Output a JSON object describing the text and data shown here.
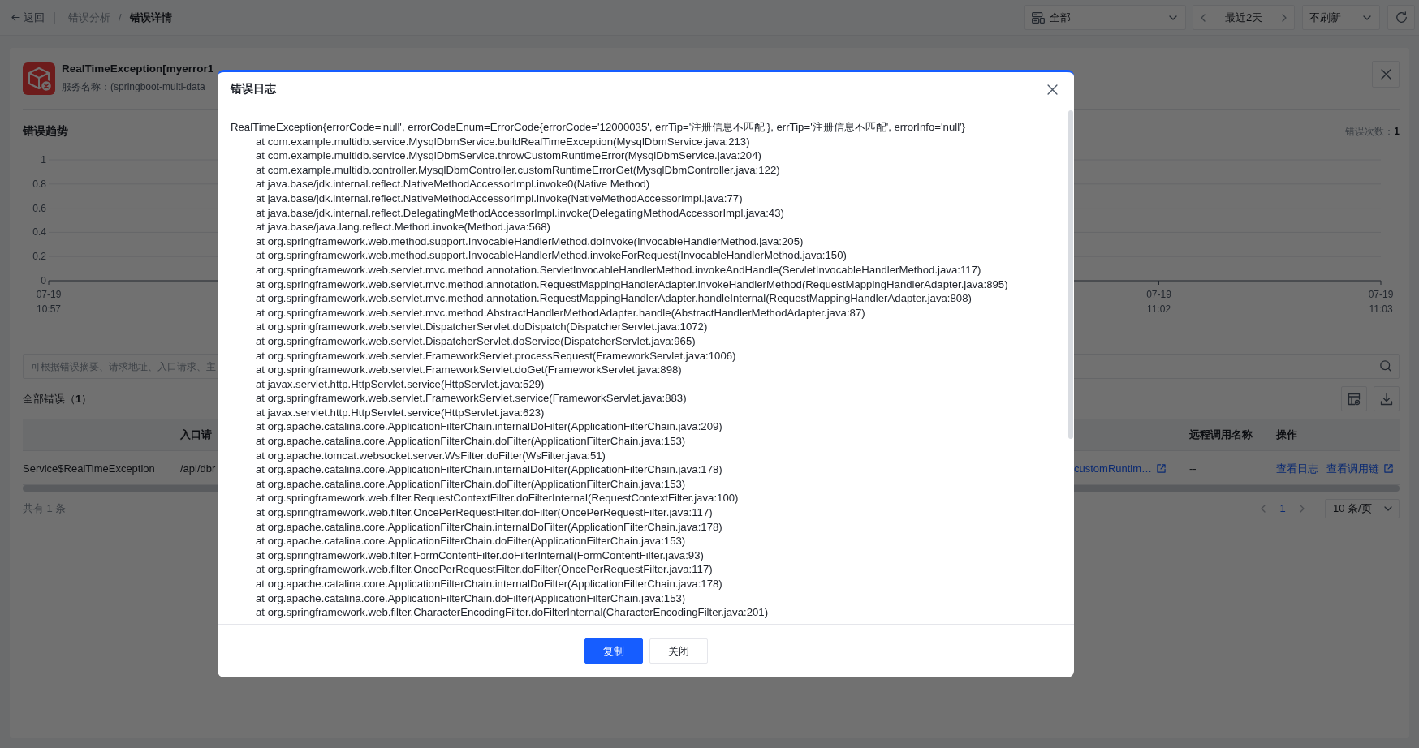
{
  "top_bar": {
    "back": "返回",
    "breadcrumb": {
      "separator": "/",
      "items": [
        {
          "label": "错误分析",
          "selected": false
        },
        {
          "label": "错误详情",
          "selected": true
        }
      ]
    },
    "environment_select": {
      "value": "全部"
    },
    "time_range": {
      "value": "最近2天"
    },
    "refresh_select": {
      "value": "不刷新"
    }
  },
  "error_header": {
    "title": "RealTimeException[myerror1",
    "service": "服务名称：(springboot-multi-data"
  },
  "trend": {
    "title": "错误趋势",
    "error_count": "错误次数：**1**",
    "chart_data": {
      "type": "line",
      "categories": [
        "07-19 10:57",
        null,
        null,
        null,
        null,
        "07-19 11:02",
        "07-19 11:03"
      ],
      "ylim": [
        0,
        1
      ],
      "yticks": [
        0,
        0.2,
        0.4,
        0.6,
        0.8,
        1
      ],
      "grid": true
    }
  },
  "search": {
    "placeholder": "可根据错误摘要、请求地址、入口请求、主"
  },
  "error_list": {
    "title": "全部错误（**1**）"
  },
  "table": {
    "columns": {
      "entry_request": "入口请",
      "remote_call_name": "远程调用名称",
      "actions": "操作"
    },
    "rows": [
      {
        "column_1": "Service$RealTimeException",
        "entry_request": "/api/dbr",
        "column_3": {
          "label": "customRuntim…",
          "external": true
        },
        "remote_call_name": "--",
        "actions": [
          {
            "label": "查看日志",
            "external": false
          },
          {
            "label": "查看调用链",
            "external": true
          }
        ]
      }
    ]
  },
  "pagination": {
    "total": "共有 1 条",
    "pages": [
      {
        "label": "1",
        "selected": true
      }
    ],
    "page_size": "10 条/页"
  },
  "modal": {
    "title": "错误日志",
    "error_log": {
      "exception": "RealTimeException{errorCode='null', errorCodeEnum=ErrorCode{errorCode='12000035', errTip='注册信息不匹配'}, errTip='注册信息不匹配', errorInfo='null'}",
      "stack_frames": [
        "at com.example.multidb.service.MysqlDbmService.buildRealTimeException(MysqlDbmService.java:213)",
        "at com.example.multidb.service.MysqlDbmService.throwCustomRuntimeError(MysqlDbmService.java:204)",
        "at com.example.multidb.controller.MysqlDbmController.customRuntimeErrorGet(MysqlDbmController.java:122)",
        "at java.base/jdk.internal.reflect.NativeMethodAccessorImpl.invoke0(Native Method)",
        "at java.base/jdk.internal.reflect.NativeMethodAccessorImpl.invoke(NativeMethodAccessorImpl.java:77)",
        "at java.base/jdk.internal.reflect.DelegatingMethodAccessorImpl.invoke(DelegatingMethodAccessorImpl.java:43)",
        "at java.base/java.lang.reflect.Method.invoke(Method.java:568)",
        "at org.springframework.web.method.support.InvocableHandlerMethod.doInvoke(InvocableHandlerMethod.java:205)",
        "at org.springframework.web.method.support.InvocableHandlerMethod.invokeForRequest(InvocableHandlerMethod.java:150)",
        "at org.springframework.web.servlet.mvc.method.annotation.ServletInvocableHandlerMethod.invokeAndHandle(ServletInvocableHandlerMethod.java:117)",
        "at org.springframework.web.servlet.mvc.method.annotation.RequestMappingHandlerAdapter.invokeHandlerMethod(RequestMappingHandlerAdapter.java:895)",
        "at org.springframework.web.servlet.mvc.method.annotation.RequestMappingHandlerAdapter.handleInternal(RequestMappingHandlerAdapter.java:808)",
        "at org.springframework.web.servlet.mvc.method.AbstractHandlerMethodAdapter.handle(AbstractHandlerMethodAdapter.java:87)",
        "at org.springframework.web.servlet.DispatcherServlet.doDispatch(DispatcherServlet.java:1072)",
        "at org.springframework.web.servlet.DispatcherServlet.doService(DispatcherServlet.java:965)",
        "at org.springframework.web.servlet.FrameworkServlet.processRequest(FrameworkServlet.java:1006)",
        "at org.springframework.web.servlet.FrameworkServlet.doGet(FrameworkServlet.java:898)",
        "at javax.servlet.http.HttpServlet.service(HttpServlet.java:529)",
        "at org.springframework.web.servlet.FrameworkServlet.service(FrameworkServlet.java:883)",
        "at javax.servlet.http.HttpServlet.service(HttpServlet.java:623)",
        "at org.apache.catalina.core.ApplicationFilterChain.internalDoFilter(ApplicationFilterChain.java:209)",
        "at org.apache.catalina.core.ApplicationFilterChain.doFilter(ApplicationFilterChain.java:153)",
        "at org.apache.tomcat.websocket.server.WsFilter.doFilter(WsFilter.java:51)",
        "at org.apache.catalina.core.ApplicationFilterChain.internalDoFilter(ApplicationFilterChain.java:178)",
        "at org.apache.catalina.core.ApplicationFilterChain.doFilter(ApplicationFilterChain.java:153)",
        "at org.springframework.web.filter.RequestContextFilter.doFilterInternal(RequestContextFilter.java:100)",
        "at org.springframework.web.filter.OncePerRequestFilter.doFilter(OncePerRequestFilter.java:117)",
        "at org.apache.catalina.core.ApplicationFilterChain.internalDoFilter(ApplicationFilterChain.java:178)",
        "at org.apache.catalina.core.ApplicationFilterChain.doFilter(ApplicationFilterChain.java:153)",
        "at org.springframework.web.filter.FormContentFilter.doFilterInternal(FormContentFilter.java:93)",
        "at org.springframework.web.filter.OncePerRequestFilter.doFilter(OncePerRequestFilter.java:117)",
        "at org.apache.catalina.core.ApplicationFilterChain.internalDoFilter(ApplicationFilterChain.java:178)",
        "at org.apache.catalina.core.ApplicationFilterChain.doFilter(ApplicationFilterChain.java:153)",
        "at org.springframework.web.filter.CharacterEncodingFilter.doFilterInternal(CharacterEncodingFilter.java:201)"
      ]
    },
    "buttons": [
      {
        "label": "复制",
        "kind": "primary"
      },
      {
        "label": "关闭",
        "kind": "secondary"
      }
    ]
  }
}
